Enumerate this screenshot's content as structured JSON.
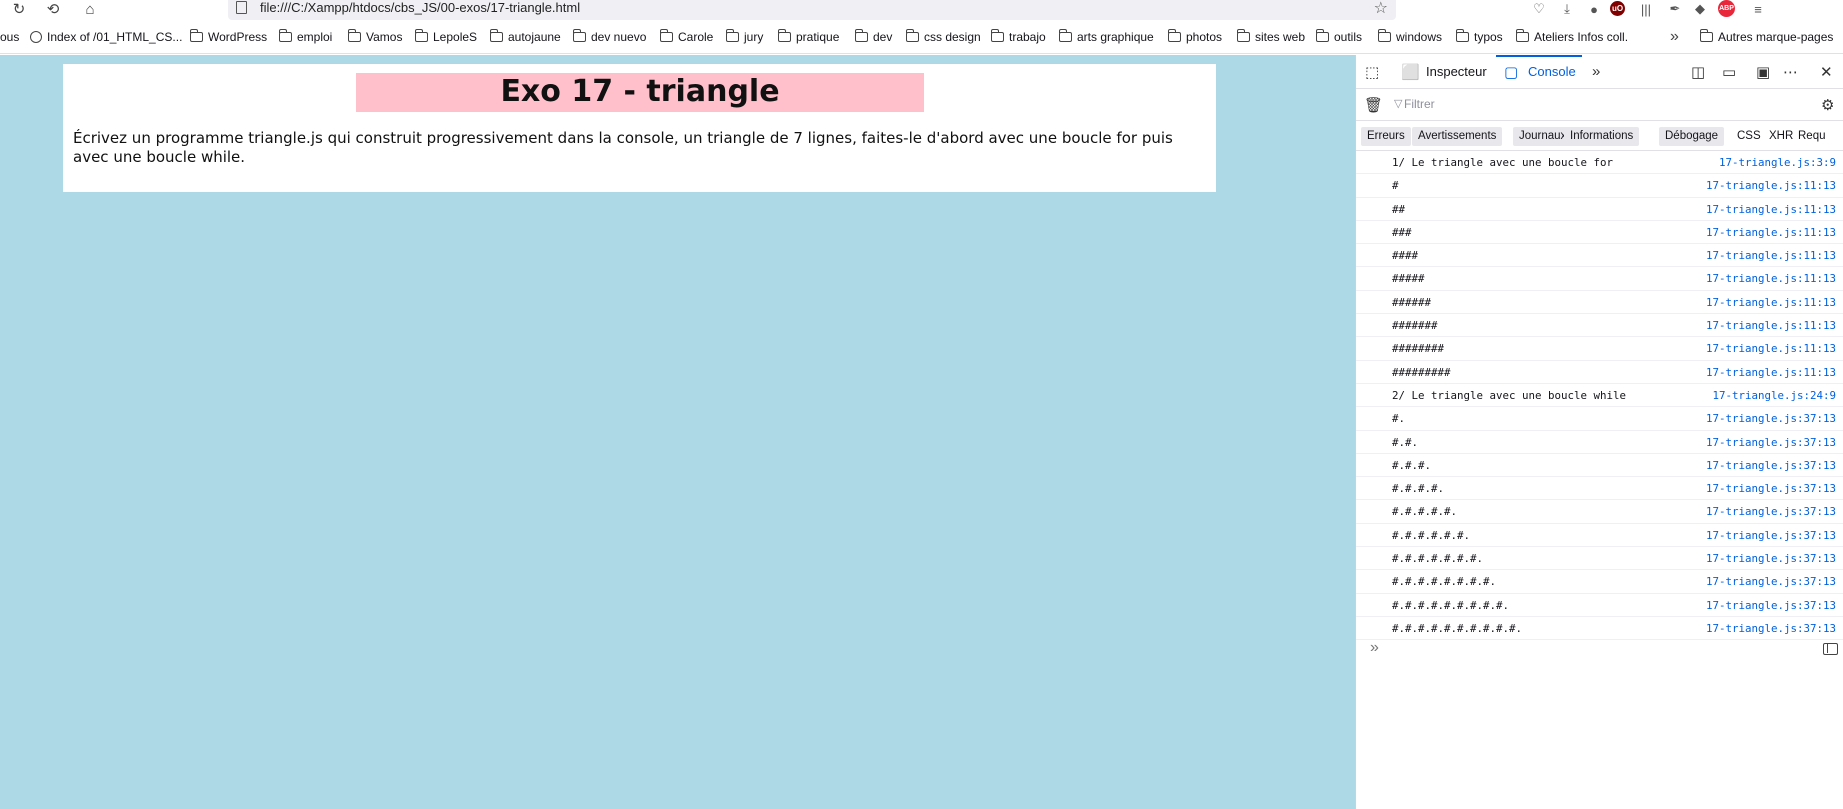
{
  "browser": {
    "url": "file:///C:/Xampp/htdocs/cbs_JS/00-exos/17-triangle.html",
    "nav_icons": [
      "reload-icon",
      "history-icon",
      "home-icon"
    ],
    "extensions": [
      {
        "name": "pocket-icon",
        "glyph": "♡"
      },
      {
        "name": "download-icon",
        "glyph": "⤓"
      },
      {
        "name": "account-icon",
        "glyph": "●"
      },
      {
        "name": "ublock-icon",
        "glyph": "uO"
      },
      {
        "name": "library-icon",
        "glyph": "|||"
      },
      {
        "name": "eyedropper-icon",
        "glyph": "✒"
      },
      {
        "name": "layers-icon",
        "glyph": "◆"
      },
      {
        "name": "adblock-icon",
        "glyph": "ABP"
      },
      {
        "name": "menu-icon",
        "glyph": "≡"
      }
    ]
  },
  "bookmarks": {
    "items": [
      {
        "label": "ous",
        "icon": "none"
      },
      {
        "label": "Index of /01_HTML_CS...",
        "icon": "globe"
      },
      {
        "label": "WordPress",
        "icon": "folder"
      },
      {
        "label": "emploi",
        "icon": "folder"
      },
      {
        "label": "Vamos",
        "icon": "folder"
      },
      {
        "label": "LepoleS",
        "icon": "folder"
      },
      {
        "label": "autojaune",
        "icon": "folder"
      },
      {
        "label": "dev nuevo",
        "icon": "folder"
      },
      {
        "label": "Carole",
        "icon": "folder"
      },
      {
        "label": "jury",
        "icon": "folder"
      },
      {
        "label": "pratique",
        "icon": "folder"
      },
      {
        "label": "dev",
        "icon": "folder"
      },
      {
        "label": "css design",
        "icon": "folder"
      },
      {
        "label": "trabajo",
        "icon": "folder"
      },
      {
        "label": "arts graphique",
        "icon": "folder"
      },
      {
        "label": "photos",
        "icon": "folder"
      },
      {
        "label": "sites web",
        "icon": "folder"
      },
      {
        "label": "outils",
        "icon": "folder"
      },
      {
        "label": "windows",
        "icon": "folder"
      },
      {
        "label": "typos",
        "icon": "folder"
      },
      {
        "label": "Ateliers Infos coll.",
        "icon": "folder"
      }
    ],
    "other": "Autres marque-pages"
  },
  "page": {
    "title": "Exo 17 - triangle",
    "description": "Écrivez un programme triangle.js qui construit progressivement dans la console, un triangle de 7 lignes, faites-le d'abord avec une boucle for puis avec une boucle while.",
    "background": "#add8e6",
    "title_background": "#ffc0cb"
  },
  "devtools": {
    "tabs": {
      "inspector": "Inspecteur",
      "console": "Console"
    },
    "filter_placeholder": "Filtrer",
    "levels": [
      "Erreurs",
      "Avertissements",
      "Journaux",
      "Informations",
      "Débogage"
    ],
    "extra_filters": [
      "CSS",
      "XHR",
      "Requ"
    ],
    "messages": [
      {
        "text": "1/ Le triangle avec une boucle for",
        "loc": "17-triangle.js:3:9"
      },
      {
        "text": "#",
        "loc": "17-triangle.js:11:13"
      },
      {
        "text": "##",
        "loc": "17-triangle.js:11:13"
      },
      {
        "text": "###",
        "loc": "17-triangle.js:11:13"
      },
      {
        "text": "####",
        "loc": "17-triangle.js:11:13"
      },
      {
        "text": "#####",
        "loc": "17-triangle.js:11:13"
      },
      {
        "text": "######",
        "loc": "17-triangle.js:11:13"
      },
      {
        "text": "#######",
        "loc": "17-triangle.js:11:13"
      },
      {
        "text": "########",
        "loc": "17-triangle.js:11:13"
      },
      {
        "text": "#########",
        "loc": "17-triangle.js:11:13"
      },
      {
        "text": "2/ Le triangle avec une boucle while",
        "loc": "17-triangle.js:24:9"
      },
      {
        "text": "#.",
        "loc": "17-triangle.js:37:13"
      },
      {
        "text": "#.#.",
        "loc": "17-triangle.js:37:13"
      },
      {
        "text": "#.#.#.",
        "loc": "17-triangle.js:37:13"
      },
      {
        "text": "#.#.#.#.",
        "loc": "17-triangle.js:37:13"
      },
      {
        "text": "#.#.#.#.#.",
        "loc": "17-triangle.js:37:13"
      },
      {
        "text": "#.#.#.#.#.#.",
        "loc": "17-triangle.js:37:13"
      },
      {
        "text": "#.#.#.#.#.#.#.",
        "loc": "17-triangle.js:37:13"
      },
      {
        "text": "#.#.#.#.#.#.#.#.",
        "loc": "17-triangle.js:37:13"
      },
      {
        "text": "#.#.#.#.#.#.#.#.#.",
        "loc": "17-triangle.js:37:13"
      },
      {
        "text": "#.#.#.#.#.#.#.#.#.#.",
        "loc": "17-triangle.js:37:13"
      }
    ]
  }
}
